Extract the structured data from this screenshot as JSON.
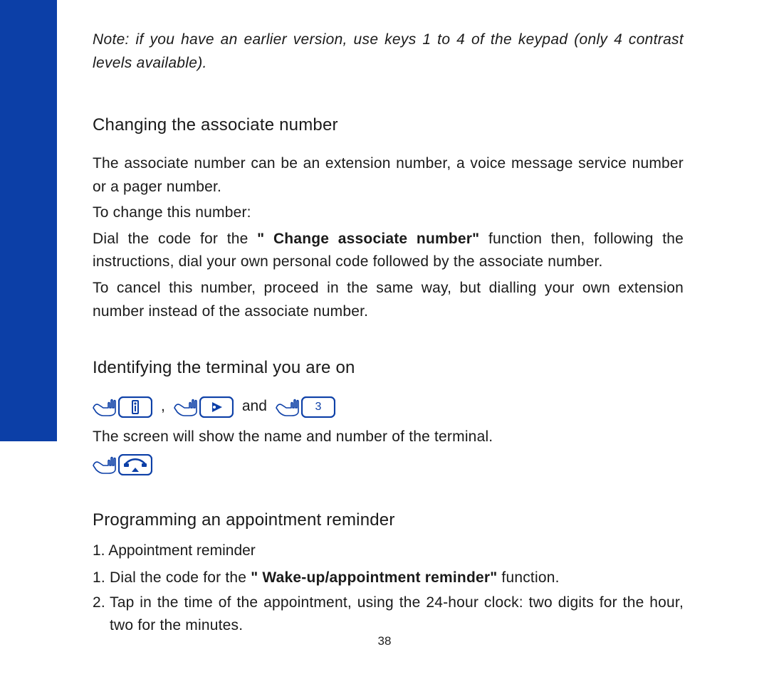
{
  "note": "Note: if you have an earlier version, use keys 1 to 4 of the keypad (only 4 contrast levels available).",
  "section1": {
    "title": "Changing the associate number",
    "p1": "The associate number can be an extension number, a voice message service number or a pager number.",
    "p2": "To change this number:",
    "p3a": "Dial the code for the ",
    "p3b": "\" Change associate number\"",
    "p3c": " function then, following the instructions, dial your own personal code followed by the associate number.",
    "p4": "To cancel this number, proceed in the same way, but dialling your own extension number instead of the associate number."
  },
  "section2": {
    "title": "Identifying the terminal you are on",
    "comma": ",",
    "and": "and",
    "p1": "The screen will show the name and number of the terminal."
  },
  "section3": {
    "title": "Programming an appointment reminder",
    "sub": "1. Appointment reminder",
    "step1a": "Dial the code for the ",
    "step1b": "\" Wake-up/appointment reminder\"",
    "step1c": " function.",
    "step2": "Tap in the time of the appointment, using the 24-hour clock: two digits for the hour, two for the minutes."
  },
  "icons": {
    "key3_digit": "3"
  },
  "page_number": "38"
}
